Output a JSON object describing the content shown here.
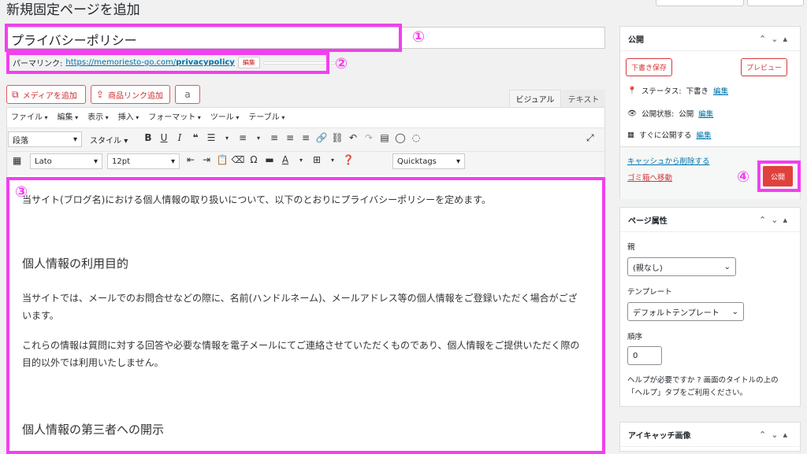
{
  "page": {
    "title": "新規固定ページを追加"
  },
  "post_title": {
    "value": "プライバシーポリシー"
  },
  "permalink": {
    "label": "パーマリンク:",
    "url_prefix": "https://memoriesto-go.com/",
    "url_slug": "privacypolicy",
    "edit_button": "編集"
  },
  "media_buttons": {
    "add_media": "メディアを追加",
    "add_product_link": "商品リンク追加"
  },
  "editor_tabs": {
    "visual": "ビジュアル",
    "text": "テキスト"
  },
  "menubar": [
    "ファイル",
    "編集",
    "表示",
    "挿入",
    "フォーマット",
    "ツール",
    "テーブル"
  ],
  "toolbar": {
    "format_select": "段落",
    "style_select": "スタイル",
    "font_select": "Lato",
    "size_select": "12pt",
    "quicktags": "Quicktags"
  },
  "content": {
    "intro": "当サイト(ブログ名)における個人情報の取り扱いについて、以下のとおりにプライバシーポリシーを定めます。",
    "heading1": "個人情報の利用目的",
    "para1": "当サイトでは、メールでのお問合せなどの際に、名前(ハンドルネーム)、メールアドレス等の個人情報をご登録いただく場合がございます。",
    "para2": "これらの情報は質問に対する回答や必要な情報を電子メールにてご連絡させていただくものであり、個人情報をご提供いただく際の目的以外では利用いたしません。",
    "heading2": "個人情報の第三者への開示"
  },
  "publish_box": {
    "title": "公開",
    "save_draft": "下書き保存",
    "preview": "プレビュー",
    "status_label": "ステータス:",
    "status_value": "下書き",
    "visibility_label": "公開状態:",
    "visibility_value": "公開",
    "schedule_label": "すぐに公開する",
    "edit_link": "編集",
    "purge_cache": "キャッシュから削除する",
    "trash": "ゴミ箱へ移動",
    "publish": "公開"
  },
  "attributes_box": {
    "title": "ページ属性",
    "parent_label": "親",
    "parent_value": "(親なし)",
    "template_label": "テンプレート",
    "template_value": "デフォルトテンプレート",
    "order_label": "順序",
    "order_value": "0",
    "help_line1": "ヘルプが必要ですか ? 画面のタイトルの上の",
    "help_line2": "「ヘルプ」タブをご利用ください。"
  },
  "featured_box": {
    "title": "アイキャッチ画像"
  },
  "annotations": {
    "n1": "①",
    "n2": "②",
    "n3": "③",
    "n4": "④",
    "color": "#f23ff0"
  }
}
